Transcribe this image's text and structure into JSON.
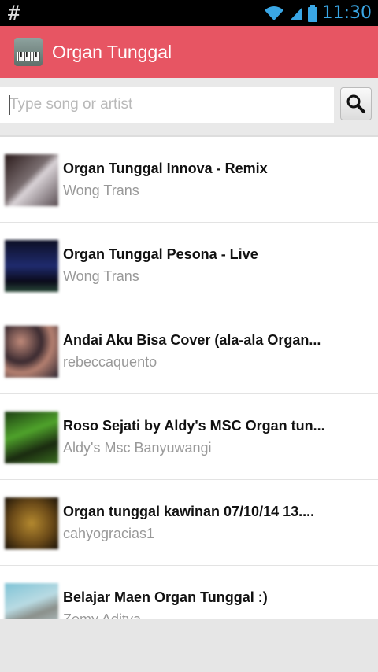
{
  "status": {
    "time": "11:30",
    "left_icon": "hash"
  },
  "app": {
    "title": "Organ Tunggal",
    "logo_icon": "keyboard-icon"
  },
  "search": {
    "placeholder": "Type song or artist",
    "button_icon": "search-icon"
  },
  "results": [
    {
      "title": "Organ Tunggal Innova - Remix",
      "artist": "Wong Trans",
      "thumb": "linear-gradient(135deg,#2b1b1b,#7a6e70 45%,#d9d3d7 55%,#5b4f54)"
    },
    {
      "title": "Organ Tunggal Pesona - Live",
      "artist": "Wong Trans",
      "thumb": "linear-gradient(180deg,#0d0f24,#1f2b6e 50%,#0a0a1a 80%,#2a4a3a)"
    },
    {
      "title": "Andai Aku Bisa Cover (ala-ala Organ...",
      "artist": "rebeccaquento",
      "thumb": "radial-gradient(circle at 30% 30%,#c08a7a,#3a2a30 40%,#b58070 60%,#2b2430)"
    },
    {
      "title": "Roso Sejati by Aldy's MSC Organ tun...",
      "artist": "Aldy's Msc Banyuwangi",
      "thumb": "linear-gradient(160deg,#1c3e12,#4fa32b 40%,#1a2a10 70%,#3a6e20)"
    },
    {
      "title": "Organ tunggal kawinan 07/10/14 13....",
      "artist": "cahyogracias1",
      "thumb": "radial-gradient(circle,#b4892f,#6b4a18 55%,#1a1208)"
    },
    {
      "title": "Belajar Maen Organ Tunggal :)",
      "artist": "Zemy Aditya",
      "thumb": "linear-gradient(160deg,#7fc3d6,#b9dbe3 40%,#8a8f8a 60%,#c9dde3)"
    }
  ]
}
